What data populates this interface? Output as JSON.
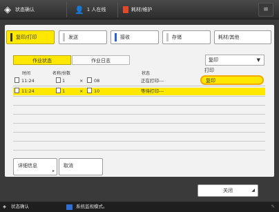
{
  "topbar": {
    "title": "状态确认",
    "item2": "1 人在线",
    "item3": "耗材/维护"
  },
  "tabs": [
    {
      "label": "复印/打印"
    },
    {
      "label": "发送"
    },
    {
      "label": "接收"
    },
    {
      "label": "存储"
    },
    {
      "label": "耗材/其他"
    }
  ],
  "subtabs": [
    {
      "label": "作业状态"
    },
    {
      "label": "作业日志"
    }
  ],
  "dropdown": {
    "value": "复印",
    "options": [
      "打印",
      "复印"
    ]
  },
  "table": {
    "headers": [
      "时间",
      "名称/份数",
      "状态"
    ],
    "rows": [
      {
        "time": "11:24",
        "copies": "1",
        "x": "×",
        "pages": "08",
        "status": "正在打印---"
      },
      {
        "time": "11:24",
        "copies": "1",
        "x": "×",
        "pages": "10",
        "status": "等待打印---"
      }
    ]
  },
  "buttons": {
    "details": "详细信息",
    "cancel": "取消",
    "close": "关闭"
  },
  "status_bar": {
    "left": "状态确认",
    "message": "系统监视模式。"
  }
}
